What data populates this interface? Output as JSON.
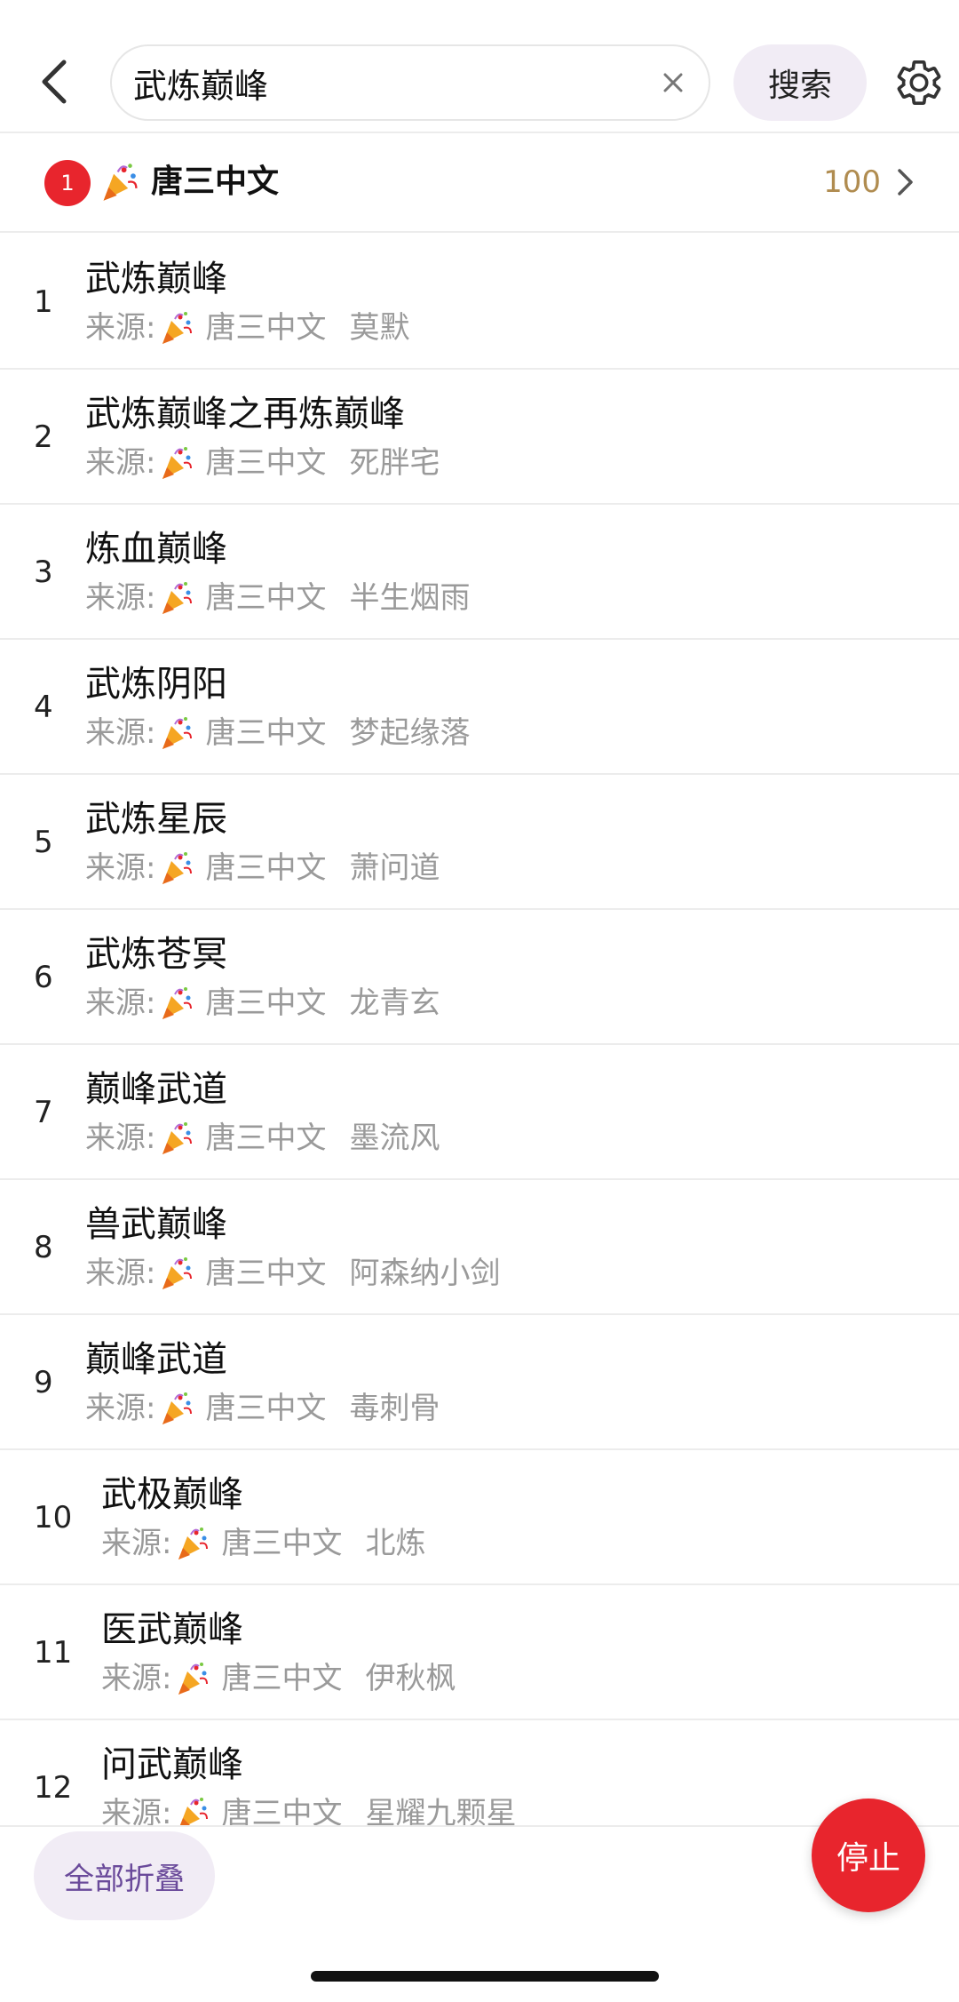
{
  "header": {
    "search_value": "武炼巅峰",
    "search_button": "搜索"
  },
  "source_summary": {
    "badge": "1",
    "name": "唐三中文",
    "count": "100"
  },
  "results": [
    {
      "num": "1",
      "title": "武炼巅峰",
      "label": "来源:",
      "source": "唐三中文",
      "author": "莫默"
    },
    {
      "num": "2",
      "title": "武炼巅峰之再炼巅峰",
      "label": "来源:",
      "source": "唐三中文",
      "author": "死胖宅"
    },
    {
      "num": "3",
      "title": "炼血巅峰",
      "label": "来源:",
      "source": "唐三中文",
      "author": "半生烟雨"
    },
    {
      "num": "4",
      "title": "武炼阴阳",
      "label": "来源:",
      "source": "唐三中文",
      "author": "梦起缘落"
    },
    {
      "num": "5",
      "title": "武炼星辰",
      "label": "来源:",
      "source": "唐三中文",
      "author": "萧问道"
    },
    {
      "num": "6",
      "title": "武炼苍冥",
      "label": "来源:",
      "source": "唐三中文",
      "author": "龙青玄"
    },
    {
      "num": "7",
      "title": "巅峰武道",
      "label": "来源:",
      "source": "唐三中文",
      "author": "墨流风"
    },
    {
      "num": "8",
      "title": "兽武巅峰",
      "label": "来源:",
      "source": "唐三中文",
      "author": "阿森纳小剑"
    },
    {
      "num": "9",
      "title": "巅峰武道",
      "label": "来源:",
      "source": "唐三中文",
      "author": "毒刺骨"
    },
    {
      "num": "10",
      "title": "武极巅峰",
      "label": "来源:",
      "source": "唐三中文",
      "author": "北炼"
    },
    {
      "num": "11",
      "title": "医武巅峰",
      "label": "来源:",
      "source": "唐三中文",
      "author": "伊秋枫"
    },
    {
      "num": "12",
      "title": "问武巅峰",
      "label": "来源:",
      "source": "唐三中文",
      "author": "星耀九颗星"
    }
  ],
  "bottom": {
    "fold_all": "全部折叠",
    "stop": "停止"
  },
  "colors": {
    "accent_red": "#e8252d",
    "count_gold": "#b08c50",
    "soft_purple_bg": "#f1ecf5",
    "fold_text": "#6a4a9a"
  },
  "icons": [
    "back-icon",
    "clear-icon",
    "settings-gear-icon",
    "party-popper-icon",
    "chevron-right-icon"
  ]
}
